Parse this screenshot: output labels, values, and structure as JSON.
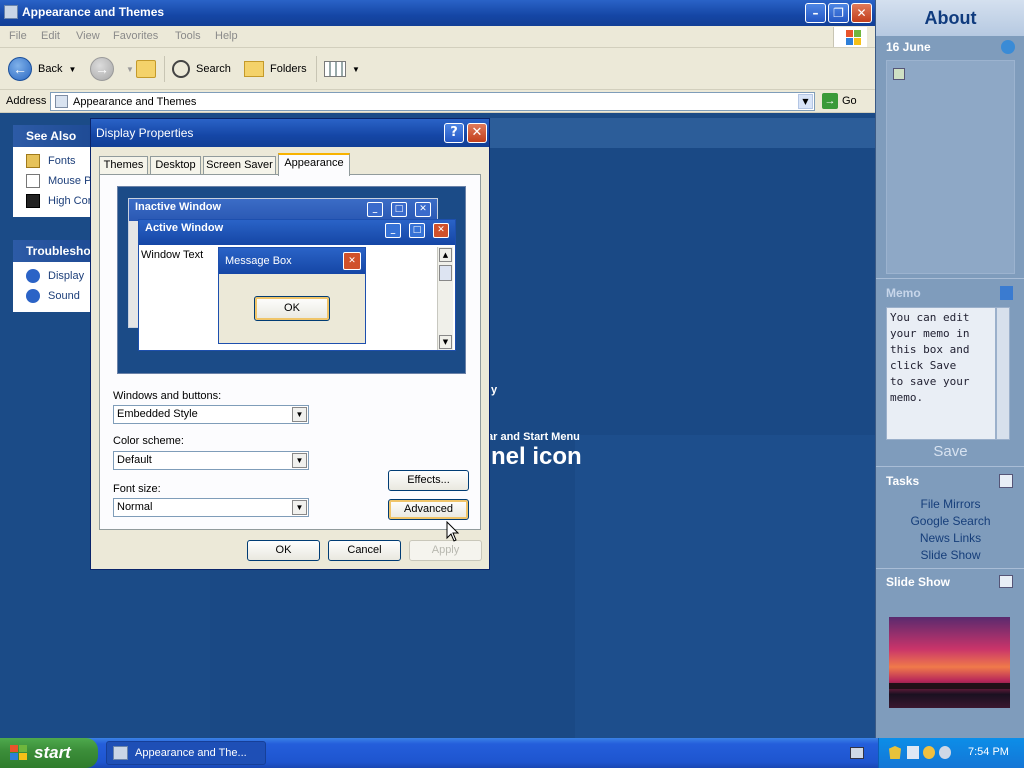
{
  "explorer": {
    "title": "Appearance and Themes",
    "menu": [
      "File",
      "Edit",
      "View",
      "Favorites",
      "Tools",
      "Help"
    ],
    "toolbar": {
      "back": "Back",
      "search": "Search",
      "folders": "Folders"
    },
    "address": {
      "label": "Address",
      "value": "Appearance and Themes",
      "go": "Go"
    },
    "see_also": {
      "title": "See Also",
      "items": [
        "Fonts",
        "Mouse P",
        "High Cor"
      ]
    },
    "troubleshoot": {
      "title": "Troublesho",
      "items": [
        "Display",
        "Sound"
      ]
    },
    "heading_fragment": "nel icon",
    "fragment_y": "y",
    "fragment_taskbar": "ar and Start Menu"
  },
  "dialog": {
    "title": "Display Properties",
    "tabs": [
      "Themes",
      "Desktop",
      "Screen Saver",
      "Appearance"
    ],
    "selected_tab": "Appearance",
    "preview": {
      "inactive_title": "Inactive Window",
      "active_title": "Active Window",
      "window_text": "Window Text",
      "message_title": "Message Box",
      "message_ok": "OK"
    },
    "windows_buttons_label": "Windows and buttons:",
    "windows_buttons_value": "Embedded Style",
    "color_scheme_label": "Color scheme:",
    "color_scheme_value": "Default",
    "font_size_label": "Font size:",
    "font_size_value": "Normal",
    "effects": "Effects...",
    "advanced": "Advanced",
    "ok": "OK",
    "cancel": "Cancel",
    "apply": "Apply"
  },
  "sidebar": {
    "title": "About",
    "date": "16 June",
    "memo_title": "Memo",
    "memo_text": "You can edit\nyour memo in\nthis box and\nclick Save\nto save your\nmemo.",
    "save": "Save",
    "tasks_title": "Tasks",
    "tasks": [
      "File Mirrors",
      "Google Search",
      "News Links",
      "Slide Show"
    ],
    "slideshow_title": "Slide Show"
  },
  "taskbar": {
    "start": "start",
    "task": "Appearance and The...",
    "clock": "7:54 PM"
  }
}
